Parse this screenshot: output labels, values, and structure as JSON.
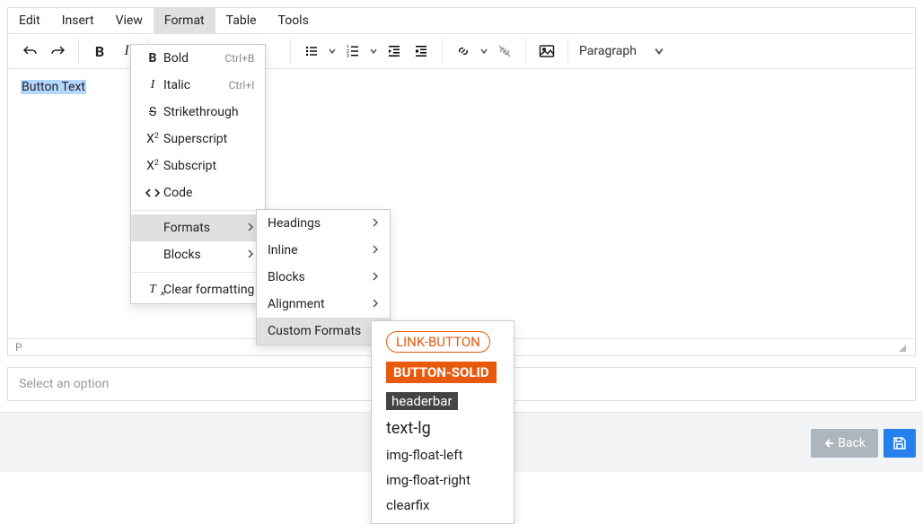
{
  "menubar": [
    "Edit",
    "Insert",
    "View",
    "Format",
    "Table",
    "Tools"
  ],
  "menubar_active_index": 3,
  "toolbar": {
    "paragraph_label": "Paragraph"
  },
  "editor": {
    "selected_text": "Button Text",
    "status_element": "P"
  },
  "format_menu": {
    "items": [
      {
        "label": "Bold",
        "shortcut": "Ctrl+B",
        "icon": "bold"
      },
      {
        "label": "Italic",
        "shortcut": "Ctrl+I",
        "icon": "italic"
      },
      {
        "label": "Strikethrough",
        "icon": "strike"
      },
      {
        "label": "Superscript",
        "icon": "superscript"
      },
      {
        "label": "Subscript",
        "icon": "subscript"
      },
      {
        "label": "Code",
        "icon": "code"
      }
    ],
    "formats_label": "Formats",
    "blocks_label": "Blocks",
    "clear_label": "Clear formatting"
  },
  "formats_submenu": [
    "Headings",
    "Inline",
    "Blocks",
    "Alignment",
    "Custom Formats"
  ],
  "formats_submenu_active_index": 4,
  "custom_formats": [
    "LINK-BUTTON",
    "BUTTON-SOLID",
    "headerbar",
    "text-lg",
    "img-float-left",
    "img-float-right",
    "clearfix"
  ],
  "select_placeholder": "Select an option",
  "footer": {
    "back_label": "Back"
  }
}
